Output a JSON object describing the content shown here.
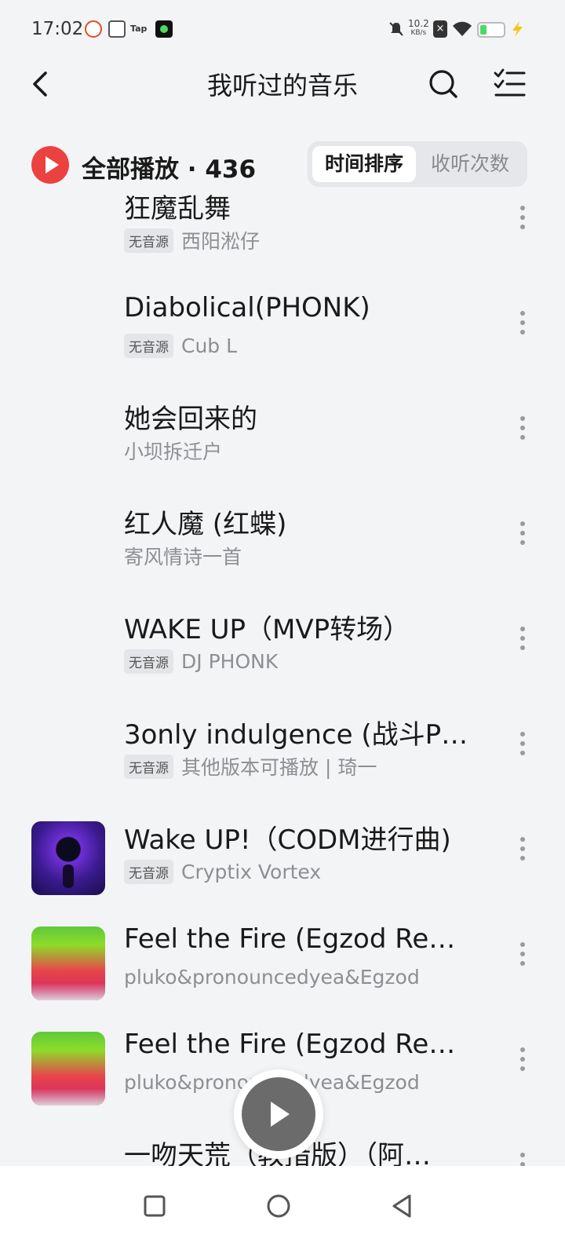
{
  "status_bar": {
    "time": "17:02",
    "speed_value": "10.2",
    "speed_unit": "KB/s",
    "icons": [
      "app-icon-red",
      "wifi-share-icon",
      "tap-icon",
      "app-icon-black",
      "mute-icon",
      "sim-off-icon",
      "wifi-icon",
      "battery-icon",
      "charging-icon"
    ],
    "tap_text": "Tap"
  },
  "header": {
    "title": "我听过的音乐",
    "icons": [
      "back-icon",
      "search-icon",
      "multiselect-icon"
    ]
  },
  "toolbar": {
    "play_all_label": "全部播放 · 436",
    "sort_options": [
      "时间排序",
      "收听次数"
    ],
    "sort_selected": "时间排序",
    "accent_color": "#ec4141"
  },
  "songs": [
    {
      "title": "狂魔乱舞",
      "badge": "无音源",
      "artist": "西阳淞仔",
      "cover": null
    },
    {
      "title": "Diabolical(PHONK)",
      "badge": "无音源",
      "artist": "Cub L",
      "cover": null
    },
    {
      "title": "她会回来的",
      "badge": "",
      "artist": "小坝拆迁户",
      "cover": null
    },
    {
      "title": "红人魔 (红蝶)",
      "badge": "",
      "artist": "寄风情诗一首",
      "cover": null
    },
    {
      "title": "WAKE UP（MVP转场）",
      "badge": "无音源",
      "artist": "DJ PHONK",
      "cover": null
    },
    {
      "title": "3only indulgence (战斗P…",
      "badge": "无音源",
      "artist": "其他版本可播放 | 琦一",
      "cover": null
    },
    {
      "title": "Wake UP!（CODM进行曲)",
      "badge": "无音源",
      "artist": "Cryptix Vortex",
      "cover": "album-art-dark-purple"
    },
    {
      "title": "Feel the Fire (Egzod Re…",
      "badge": "",
      "artist": "pluko&pronouncedyea&Egzod",
      "cover": "album-art-green-red"
    },
    {
      "title": "Feel the Fire (Egzod Re…",
      "badge": "",
      "artist": "pluko&pronouncedyea&Egzod",
      "cover": "album-art-green-red"
    },
    {
      "title": "一吻天荒（教措版）（阿…",
      "badge": "",
      "artist": "",
      "cover": null
    }
  ],
  "floating_player": {
    "icon": "play-icon"
  },
  "nav_bar": {
    "icons": [
      "recent-apps-icon",
      "home-icon",
      "back-nav-icon"
    ]
  }
}
